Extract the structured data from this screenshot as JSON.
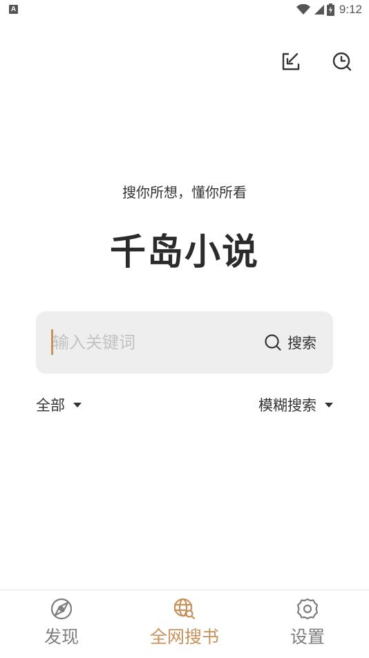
{
  "status_bar": {
    "app_badge": "A",
    "time": "9:12",
    "icons": [
      "wifi-icon",
      "signal-icon",
      "battery-charging-icon"
    ]
  },
  "header_actions": {
    "icons": [
      "download-check-icon",
      "history-clock-icon"
    ]
  },
  "hero": {
    "slogan": "搜你所想，懂你所看",
    "title": "千岛小说"
  },
  "search": {
    "placeholder": "输入关键词",
    "value": "",
    "button_label": "搜索",
    "button_icon": "search-icon"
  },
  "filters": {
    "scope_label": "全部",
    "mode_label": "模糊搜索"
  },
  "bottom_nav": {
    "items": [
      {
        "label": "发现",
        "icon": "compass-icon",
        "active": false
      },
      {
        "label": "全网搜书",
        "icon": "globe-search-icon",
        "active": true
      },
      {
        "label": "设置",
        "icon": "gear-icon",
        "active": false
      }
    ]
  },
  "colors": {
    "accent": "#c9915a",
    "inactive": "#7d7d7d",
    "search_bg": "#eeeeee",
    "text": "#333333"
  }
}
